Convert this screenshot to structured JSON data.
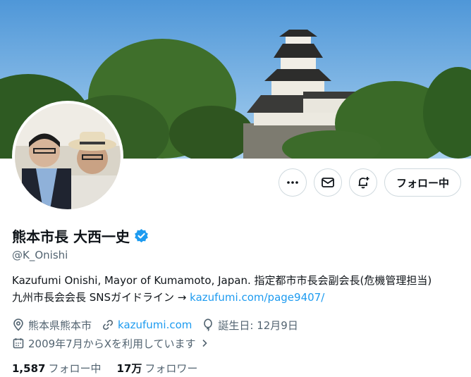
{
  "profile": {
    "display_name": "熊本市長 大西一史",
    "handle": "@K_Onishi",
    "bio_line1": "Kazufumi Onishi, Mayor of Kumamoto, Japan. 指定都市市長会副会長(危機管理担当)",
    "bio_line2_prefix": "九州市長会会長 SNSガイドライン → ",
    "bio_link": "kazufumi.com/page9407/",
    "location": "熊本県熊本市",
    "website": "kazufumi.com",
    "birthday": "誕生日: 12月9日",
    "joined": "2009年7月からXを利用しています",
    "following_count": "1,587",
    "following_label": "フォロー中",
    "followers_count": "17万",
    "followers_label": "フォロワー"
  },
  "actions": {
    "follow_label": "フォロー中"
  },
  "icons": {
    "more": "more-icon",
    "message": "mail-icon",
    "notify": "bell-plus-icon",
    "verified": "verified-badge-icon",
    "location": "location-icon",
    "link": "link-icon",
    "birthday": "balloon-icon",
    "calendar": "calendar-icon"
  },
  "colors": {
    "link": "#1d9bf0",
    "verified": "#1d9bf0",
    "secondary_text": "#536471",
    "button_border": "#cfd9de"
  }
}
